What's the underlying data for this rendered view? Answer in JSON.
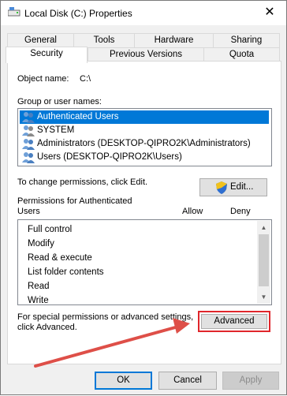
{
  "window": {
    "title": "Local Disk (C:) Properties",
    "close_glyph": "✕"
  },
  "tabs": {
    "row1": [
      {
        "label": "General"
      },
      {
        "label": "Tools"
      },
      {
        "label": "Hardware"
      },
      {
        "label": "Sharing"
      }
    ],
    "row2": [
      {
        "label": "Security",
        "active": true
      },
      {
        "label": "Previous Versions"
      },
      {
        "label": "Quota"
      }
    ]
  },
  "security": {
    "object_name_label": "Object name:",
    "object_name_value": "C:\\",
    "group_label": "Group or user names:",
    "users": [
      {
        "name": "Authenticated Users",
        "selected": true
      },
      {
        "name": "SYSTEM"
      },
      {
        "name": "Administrators (DESKTOP-QIPRO2K\\Administrators)"
      },
      {
        "name": "Users (DESKTOP-QIPRO2K\\Users)"
      }
    ],
    "change_text": "To change permissions, click Edit.",
    "edit_button": "Edit...",
    "permissions_header": "Permissions for Authenticated",
    "permissions_header_2": "Users",
    "allow_label": "Allow",
    "deny_label": "Deny",
    "permissions": [
      {
        "name": "Full control"
      },
      {
        "name": "Modify"
      },
      {
        "name": "Read & execute"
      },
      {
        "name": "List folder contents"
      },
      {
        "name": "Read"
      },
      {
        "name": "Write"
      }
    ],
    "special_text": "For special permissions or advanced settings,",
    "special_text_2": "click Advanced.",
    "advanced_button": "Advanced"
  },
  "footer": {
    "ok": "OK",
    "cancel": "Cancel",
    "apply": "Apply"
  },
  "colors": {
    "selection": "#0078d7",
    "highlight": "#e0262b",
    "arrow": "#de4f48"
  },
  "icons": {
    "title": "drive-icon",
    "user": "user-group-icon",
    "shield": "shield-icon"
  }
}
